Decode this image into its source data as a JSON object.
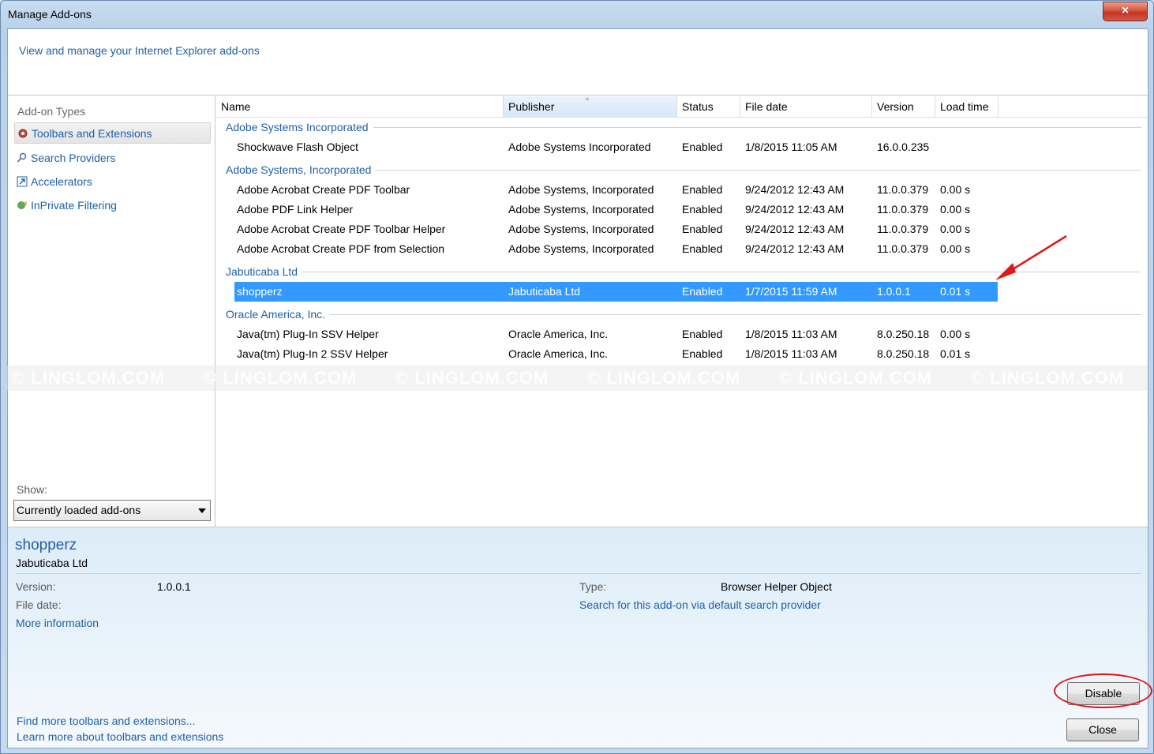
{
  "window": {
    "title": "Manage Add-ons",
    "close_glyph": "×"
  },
  "header": {
    "link_text": "View and manage your Internet Explorer add-ons"
  },
  "sidebar": {
    "heading": "Add-on Types",
    "items": [
      {
        "label": "Toolbars and Extensions",
        "icon": "gear-icon",
        "selected": true
      },
      {
        "label": "Search Providers",
        "icon": "search-icon",
        "selected": false
      },
      {
        "label": "Accelerators",
        "icon": "accelerator-icon",
        "selected": false
      },
      {
        "label": "InPrivate Filtering",
        "icon": "inprivate-icon",
        "selected": false
      }
    ],
    "show_label": "Show:",
    "show_value": "Currently loaded add-ons"
  },
  "columns": [
    "Name",
    "Publisher",
    "Status",
    "File date",
    "Version",
    "Load time"
  ],
  "groups": [
    {
      "name": "Adobe Systems Incorporated",
      "rows": [
        {
          "name": "Shockwave Flash Object",
          "publisher": "Adobe Systems Incorporated",
          "status": "Enabled",
          "file_date": "1/8/2015 11:05 AM",
          "version": "16.0.0.235",
          "load_time": ""
        }
      ]
    },
    {
      "name": "Adobe Systems, Incorporated",
      "rows": [
        {
          "name": "Adobe Acrobat Create PDF Toolbar",
          "publisher": "Adobe Systems, Incorporated",
          "status": "Enabled",
          "file_date": "9/24/2012 12:43 AM",
          "version": "11.0.0.379",
          "load_time": "0.00 s"
        },
        {
          "name": "Adobe PDF Link Helper",
          "publisher": "Adobe Systems, Incorporated",
          "status": "Enabled",
          "file_date": "9/24/2012 12:43 AM",
          "version": "11.0.0.379",
          "load_time": "0.00 s"
        },
        {
          "name": "Adobe Acrobat Create PDF Toolbar Helper",
          "publisher": "Adobe Systems, Incorporated",
          "status": "Enabled",
          "file_date": "9/24/2012 12:43 AM",
          "version": "11.0.0.379",
          "load_time": "0.00 s"
        },
        {
          "name": "Adobe Acrobat Create PDF from Selection",
          "publisher": "Adobe Systems, Incorporated",
          "status": "Enabled",
          "file_date": "9/24/2012 12:43 AM",
          "version": "11.0.0.379",
          "load_time": "0.00 s"
        }
      ]
    },
    {
      "name": "Jabuticaba Ltd",
      "rows": [
        {
          "name": "shopperz",
          "publisher": "Jabuticaba Ltd",
          "status": "Enabled",
          "file_date": "1/7/2015 11:59 AM",
          "version": "1.0.0.1",
          "load_time": "0.01 s",
          "selected": true
        }
      ]
    },
    {
      "name": "Oracle America, Inc.",
      "rows": [
        {
          "name": "Java(tm) Plug-In SSV Helper",
          "publisher": "Oracle America, Inc.",
          "status": "Enabled",
          "file_date": "1/8/2015 11:03 AM",
          "version": "8.0.250.18",
          "load_time": "0.00 s"
        },
        {
          "name": "Java(tm) Plug-In 2 SSV Helper",
          "publisher": "Oracle America, Inc.",
          "status": "Enabled",
          "file_date": "1/8/2015 11:03 AM",
          "version": "8.0.250.18",
          "load_time": "0.01 s"
        }
      ]
    }
  ],
  "watermark": "© LINGLOM.COM",
  "details": {
    "name": "shopperz",
    "publisher": "Jabuticaba Ltd",
    "version_label": "Version:",
    "version_value": "1.0.0.1",
    "file_date_label": "File date:",
    "more_info": "More information",
    "type_label": "Type:",
    "type_value": "Browser Helper Object",
    "search_link": "Search for this add-on via default search provider"
  },
  "footer": {
    "find_more": "Find more toolbars and extensions...",
    "learn_more": "Learn more about toolbars and extensions",
    "disable_label": "Disable",
    "close_label": "Close"
  },
  "colors": {
    "link": "#1f5fa8",
    "selection": "#3399ff",
    "annotation": "#e01818"
  }
}
